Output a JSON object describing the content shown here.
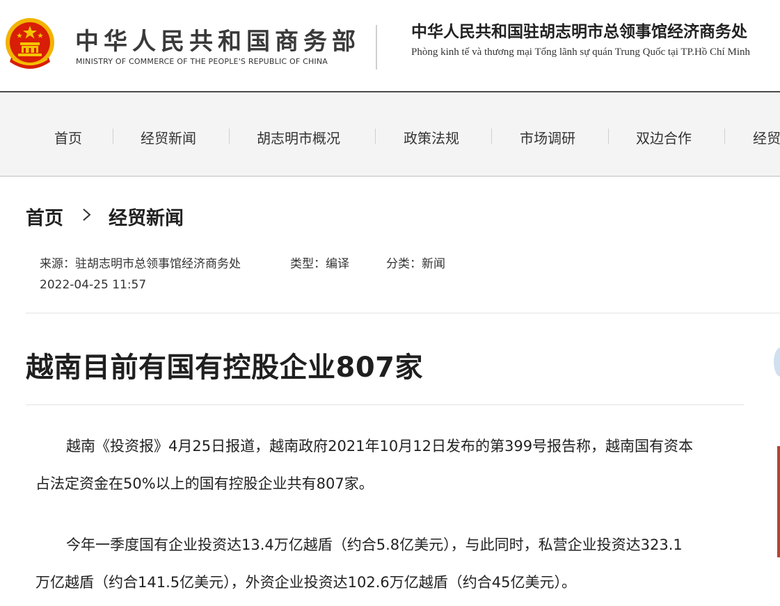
{
  "header": {
    "ministry_cn": "中华人民共和国商务部",
    "ministry_en": "MINISTRY OF COMMERCE OF THE PEOPLE'S REPUBLIC OF CHINA",
    "consulate_cn": "中华人民共和国驻胡志明市总领事馆经济商务处",
    "consulate_vn": "Phòng kinh tế và thương mại Tổng lãnh sự quán Trung Quốc tại TP.Hồ Chí Minh"
  },
  "nav": {
    "items": [
      "首页",
      "经贸新闻",
      "胡志明市概况",
      "政策法规",
      "市场调研",
      "双边合作",
      "经贸"
    ]
  },
  "breadcrumb": {
    "home": "首页",
    "current": "经贸新闻"
  },
  "meta": {
    "source": "来源：驻胡志明市总领事馆经济商务处",
    "type": "类型：编译",
    "category": "分类：新闻",
    "date": "2022-04-25 11:57"
  },
  "article": {
    "title": "越南目前有国有控股企业807家",
    "paragraphs": [
      {
        "lines": [
          "越南《投资报》4月25日报道，越南政府2021年10月12日发布的第399号报告称，越南国有资本",
          "占法定资金在50%以上的国有控股企业共有807家。"
        ]
      },
      {
        "lines": [
          "今年一季度国有企业投资达13.4万亿越盾（约合5.8亿美元），与此同时，私营企业投资达323.1",
          "万亿越盾（约合141.5亿美元），外资企业投资达102.6万亿越盾（约合45亿美元）。"
        ]
      }
    ]
  },
  "colors": {
    "emblem_red": "#d81e06",
    "emblem_gold": "#f5c400",
    "nav_bg": "#f4f4f4",
    "header_rule": "#4a4a4a",
    "text": "#222222"
  }
}
